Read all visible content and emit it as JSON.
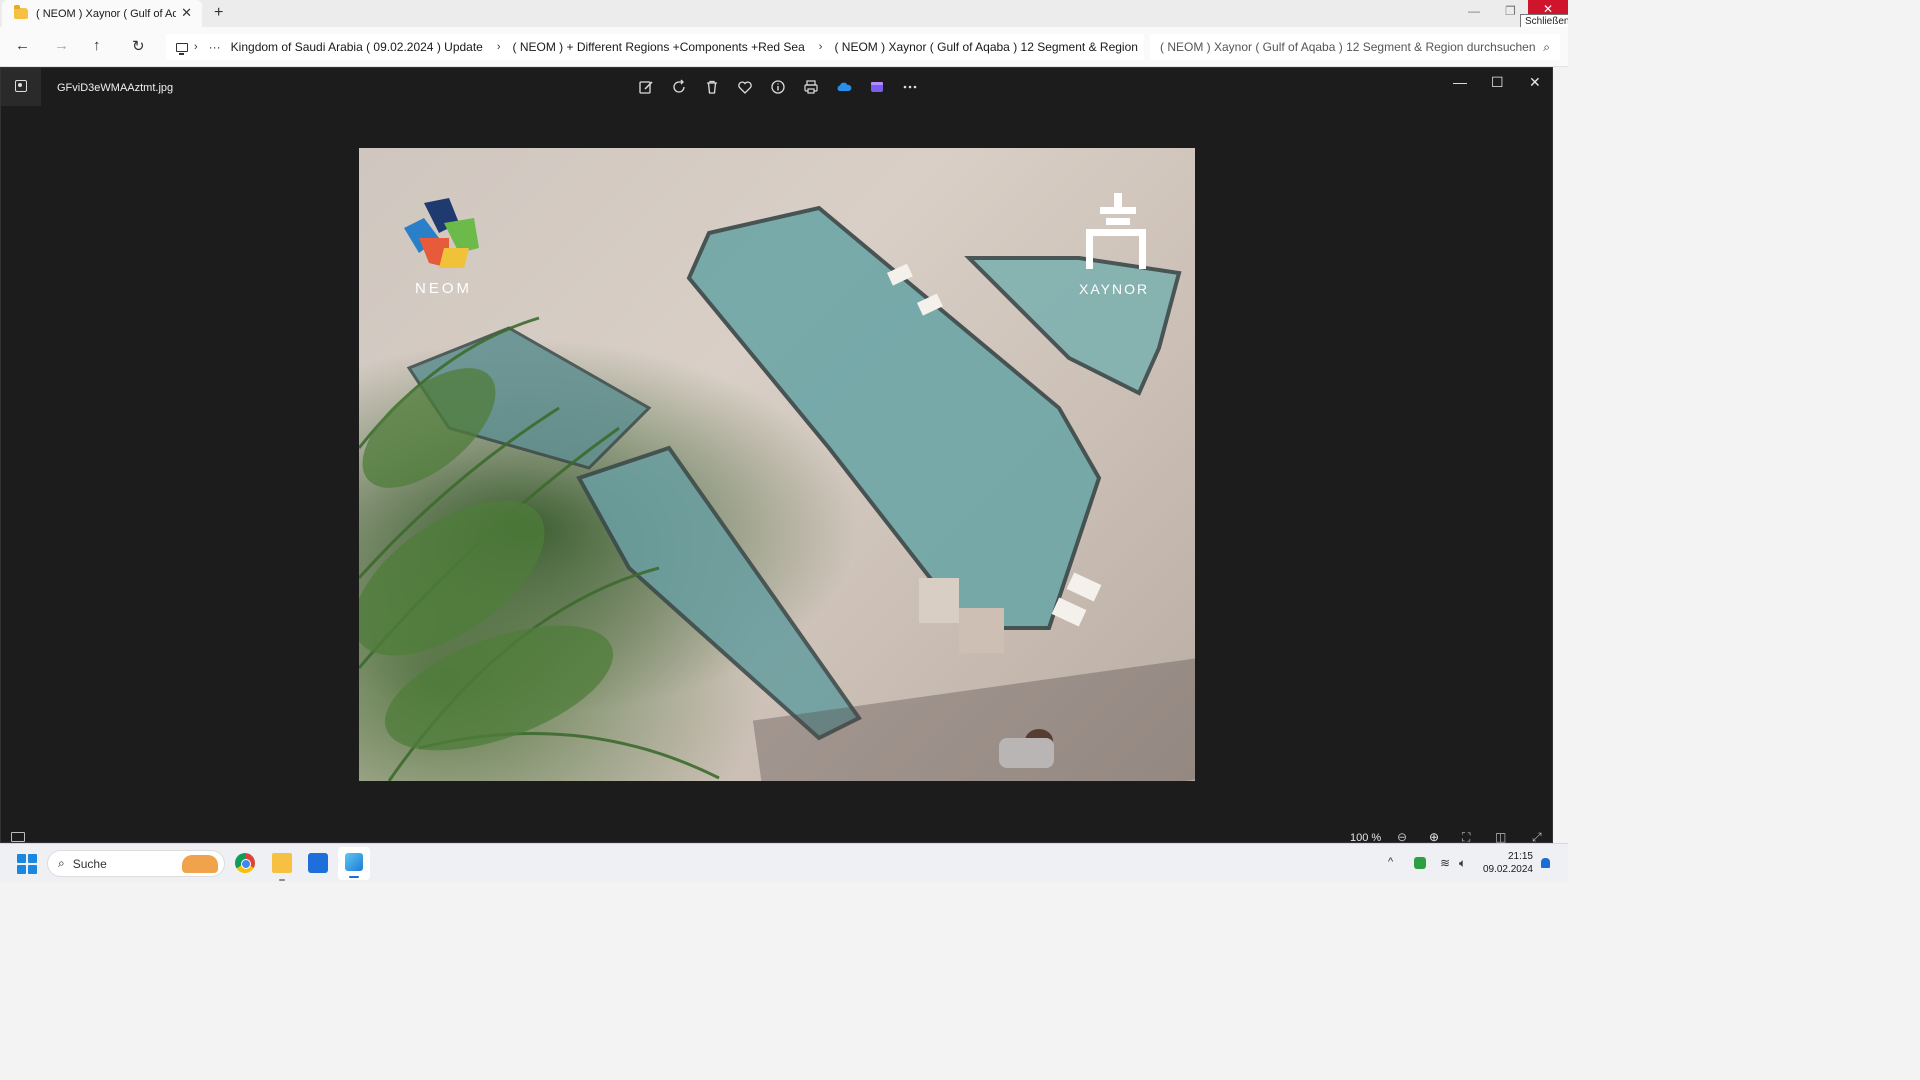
{
  "explorer": {
    "tab_title": "( NEOM ) Xaynor ( Gulf of Aqa",
    "tab_close": "✕",
    "new_tab": "+",
    "window_minimize": "—",
    "window_maximize": "❐",
    "window_close": "✕",
    "close_tooltip": "Schließen",
    "nav": {
      "back": "←",
      "forward": "→",
      "up": "↑",
      "refresh": "↻"
    },
    "breadcrumb_more": "···",
    "breadcrumbs": [
      "Kingdom of Saudi Arabia ( 09.02.2024 ) Update",
      "( NEOM ) + Different Regions +Components +Red Sea",
      "( NEOM ) Xaynor ( Gulf of Aqaba ) 12 Segment & Region"
    ],
    "search_placeholder": "( NEOM ) Xaynor ( Gulf of Aqaba ) 12 Segment & Region durchsuchen"
  },
  "viewer": {
    "file_name": "GFviD3eWMAAztmt.jpg",
    "toolbar": [
      "edit-icon",
      "rotate-icon",
      "delete-icon",
      "favorite-icon",
      "info-icon",
      "print-icon",
      "onedrive-icon",
      "clipchamp-icon",
      "more-icon"
    ],
    "window_minimize": "—",
    "window_maximize": "☐",
    "window_close": "✕",
    "zoom_label": "100 %",
    "photo": {
      "logo_left": "NEOM",
      "logo_right": "XAYNOR"
    }
  },
  "taskbar": {
    "search_text": "Suche",
    "time": "21:15",
    "date": "09.02.2024",
    "tray_chevron": "^",
    "accent": "#1a6fd6"
  }
}
